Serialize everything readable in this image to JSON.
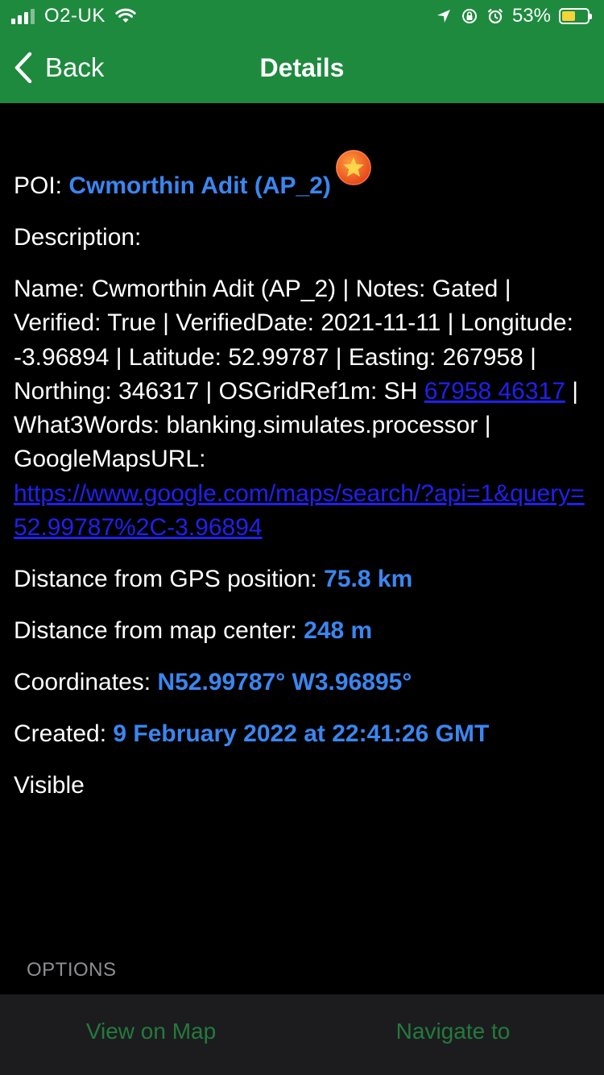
{
  "status_bar": {
    "carrier": "O2-UK",
    "battery_percent": "53%",
    "battery_level": 0.53,
    "battery_color": "#f5d33a",
    "icons": [
      "signal-icon",
      "wifi-icon",
      "location-arrow-icon",
      "orientation-lock-icon",
      "alarm-icon",
      "battery-icon"
    ]
  },
  "nav": {
    "back_label": "Back",
    "title": "Details",
    "background_color": "#1e8a3e"
  },
  "poi": {
    "label": "POI: ",
    "name": "Cwmorthin Adit (AP_2)",
    "badge_icon": "star-badge-icon"
  },
  "description": {
    "label": "Description:",
    "text_1": "Name: Cwmorthin Adit (AP_2) | Notes: Gated | Verified: True | VerifiedDate: 2021-11-11 | Longitude: -3.96894 | Latitude: 52.99787 | Easting: 267958 | Northing: 346317 | OSGridRef1m: SH ",
    "grid_link": "67958 46317",
    "text_2": " | What3Words: blanking.simulates.processor | GoogleMapsURL: ",
    "maps_url": "https://www.google.com/maps/search/?api=1&query=52.99787%2C-3.96894"
  },
  "details": {
    "gps_distance_label": "Distance from GPS position: ",
    "gps_distance_value": "75.8 km",
    "map_distance_label": "Distance from map center: ",
    "map_distance_value": "248 m",
    "coordinates_label": "Coordinates: ",
    "coordinates_value": "N52.99787° W3.96895°",
    "created_label": "Created: ",
    "created_value": "9 February 2022 at 22:41:26 GMT",
    "visibility": "Visible"
  },
  "options": {
    "section_label": "OPTIONS",
    "view_on_map": "View on Map",
    "navigate_to": "Navigate to"
  },
  "colors": {
    "accent_blue": "#3b86f0",
    "link_blue": "#2020ee",
    "option_green": "#237a3d"
  }
}
